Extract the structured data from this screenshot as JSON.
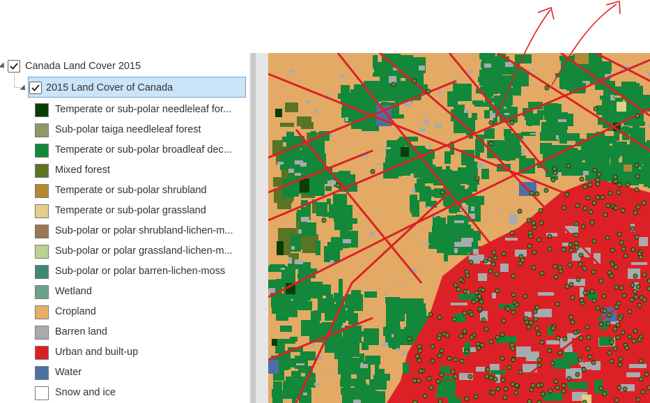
{
  "contents": {
    "group_layer": {
      "label": "Canada Land Cover 2015",
      "checked": true
    },
    "map_layer": {
      "label": "2015 Land Cover of Canada",
      "checked": true,
      "selected": true
    },
    "legend": [
      {
        "label": "Temperate or sub-polar needleleaf for...",
        "color": "#0b3d0b"
      },
      {
        "label": "Sub-polar taiga needleleaf forest",
        "color": "#8e9868"
      },
      {
        "label": "Temperate or sub-polar broadleaf dec...",
        "color": "#13873a"
      },
      {
        "label": "Mixed forest",
        "color": "#5a7424"
      },
      {
        "label": "Temperate or sub-polar shrubland",
        "color": "#b38a33"
      },
      {
        "label": "Temperate or sub-polar grassland",
        "color": "#e1cf8a"
      },
      {
        "label": "Sub-polar or polar shrubland-lichen-m...",
        "color": "#9c7554"
      },
      {
        "label": "Sub-polar or polar grassland-lichen-m...",
        "color": "#bad48f"
      },
      {
        "label": "Sub-polar or polar barren-lichen-moss",
        "color": "#3f8970"
      },
      {
        "label": "Wetland",
        "color": "#6ba38a"
      },
      {
        "label": "Cropland",
        "color": "#e6ae66"
      },
      {
        "label": "Barren land",
        "color": "#a8abae"
      },
      {
        "label": "Urban and built-up",
        "color": "#dc2126"
      },
      {
        "label": "Water",
        "color": "#4c70a3"
      },
      {
        "label": "Snow and ice",
        "color": "#ffffff"
      }
    ]
  },
  "annotation": {
    "color": "#e0201e"
  }
}
